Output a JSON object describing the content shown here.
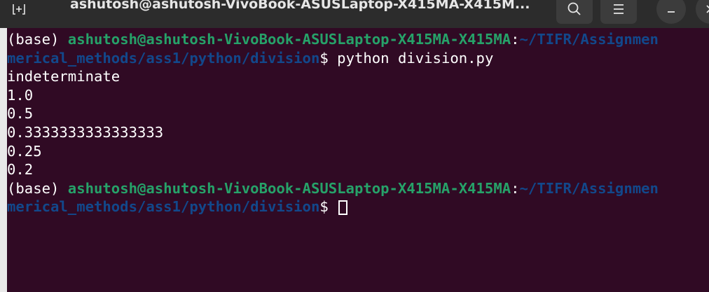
{
  "window": {
    "title": "ashutosh@ashutosh-VivoBook-ASUSLaptop-X415MA-X415M...",
    "icons": {
      "new_tab": "new-tab-icon",
      "search": "search-icon",
      "menu": "hamburger-menu-icon",
      "minimize": "minimize-icon",
      "close": "close-icon"
    }
  },
  "terminal": {
    "colors": {
      "background": "#300a24",
      "user_host": "#26a269",
      "path": "#12488b",
      "text": "#ffffff",
      "titlebar": "#2c2c2c"
    },
    "prompt1": {
      "env": "(base) ",
      "user_host": "ashutosh@ashutosh-VivoBook-ASUSLaptop-X415MA-X415MA",
      "colon": ":",
      "path_start": "~/TIFR/Assignmen",
      "path_wrap": "merical_methods/ass1/python/division",
      "dollar": "$ ",
      "command": "python division.py"
    },
    "output": [
      "indeterminate",
      "1.0",
      "0.5",
      "0.3333333333333333",
      "0.25",
      "0.2"
    ],
    "prompt2": {
      "env": "(base) ",
      "user_host": "ashutosh@ashutosh-VivoBook-ASUSLaptop-X415MA-X415MA",
      "colon": ":",
      "path_start": "~/TIFR/Assignmen",
      "path_wrap": "merical_methods/ass1/python/division",
      "dollar": "$ "
    }
  }
}
